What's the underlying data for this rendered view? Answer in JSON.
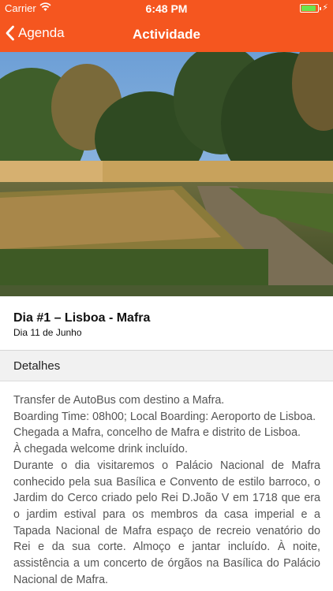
{
  "status_bar": {
    "carrier": "Carrier",
    "time": "6:48 PM",
    "battery_level": 0.9,
    "wifi_icon": "wifi-icon",
    "battery_icon": "battery-icon",
    "charging_icon": "bolt-icon"
  },
  "nav": {
    "back_label": "Agenda",
    "back_icon": "chevron-left-icon",
    "title": "Actividade"
  },
  "colors": {
    "accent": "#f5561f",
    "section_bg": "#f1f1f1",
    "battery": "#6be34d"
  },
  "activity": {
    "title": "Dia #1 – Lisboa - Mafra",
    "date": "Dia 11 de Junho"
  },
  "details": {
    "header": "Detalhes",
    "paragraphs": [
      "Transfer de AutoBus com destino a Mafra.",
      "Boarding Time: 08h00; Local Boarding: Aeroporto de Lisboa.",
      "Chegada a Mafra, concelho de Mafra e distrito de Lisboa.",
      "À chegada welcome drink incluído.",
      "Durante o dia visitaremos o Palácio Nacional de Mafra conhecido pela sua Basílica e Convento de estilo barroco, o Jardim do Cerco criado pelo Rei D.João V em 1718 que era o jardim estival para os membros da casa imperial e a Tapada Nacional de Mafra espaço de recreio venatório do Rei e da sua corte. Almoço e jantar incluído. À noite, assistência a um concerto de órgãos na Basílica do Palácio Nacional de Mafra."
    ]
  }
}
